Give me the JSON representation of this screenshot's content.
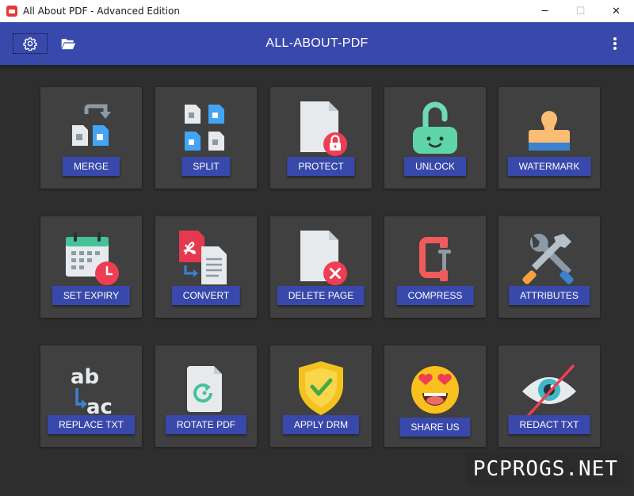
{
  "window": {
    "title": "All About PDF - Advanced Edition",
    "controls": {
      "minimize": "─",
      "maximize": "☐",
      "close": "✕"
    }
  },
  "header": {
    "title": "ALL-ABOUT-PDF",
    "settings_icon": "gear-icon",
    "folder_icon": "folder-open-icon",
    "menu_icon": "more-vert-icon",
    "background": "#3949ab"
  },
  "tiles": [
    {
      "label": "MERGE",
      "icon": "merge-icon"
    },
    {
      "label": "SPLIT",
      "icon": "split-icon"
    },
    {
      "label": "PROTECT",
      "icon": "protect-icon"
    },
    {
      "label": "UNLOCK",
      "icon": "unlock-icon"
    },
    {
      "label": "WATERMARK",
      "icon": "stamp-icon"
    },
    {
      "label": "SET EXPIRY",
      "icon": "calendar-clock-icon"
    },
    {
      "label": "CONVERT",
      "icon": "convert-icon"
    },
    {
      "label": "DELETE PAGE",
      "icon": "delete-page-icon"
    },
    {
      "label": "COMPRESS",
      "icon": "clamp-icon"
    },
    {
      "label": "ATTRIBUTES",
      "icon": "tools-icon"
    },
    {
      "label": "REPLACE TXT",
      "icon": "replace-text-icon"
    },
    {
      "label": "ROTATE PDF",
      "icon": "rotate-icon"
    },
    {
      "label": "APPLY DRM",
      "icon": "shield-check-icon"
    },
    {
      "label": "SHARE US",
      "icon": "heart-eyes-emoji-icon"
    },
    {
      "label": "REDACT TXT",
      "icon": "eye-slash-icon"
    }
  ],
  "watermark": "PCPROGS.NET",
  "colors": {
    "accent": "#3949ab",
    "tile": "#404040",
    "background": "#2e2e2e"
  }
}
